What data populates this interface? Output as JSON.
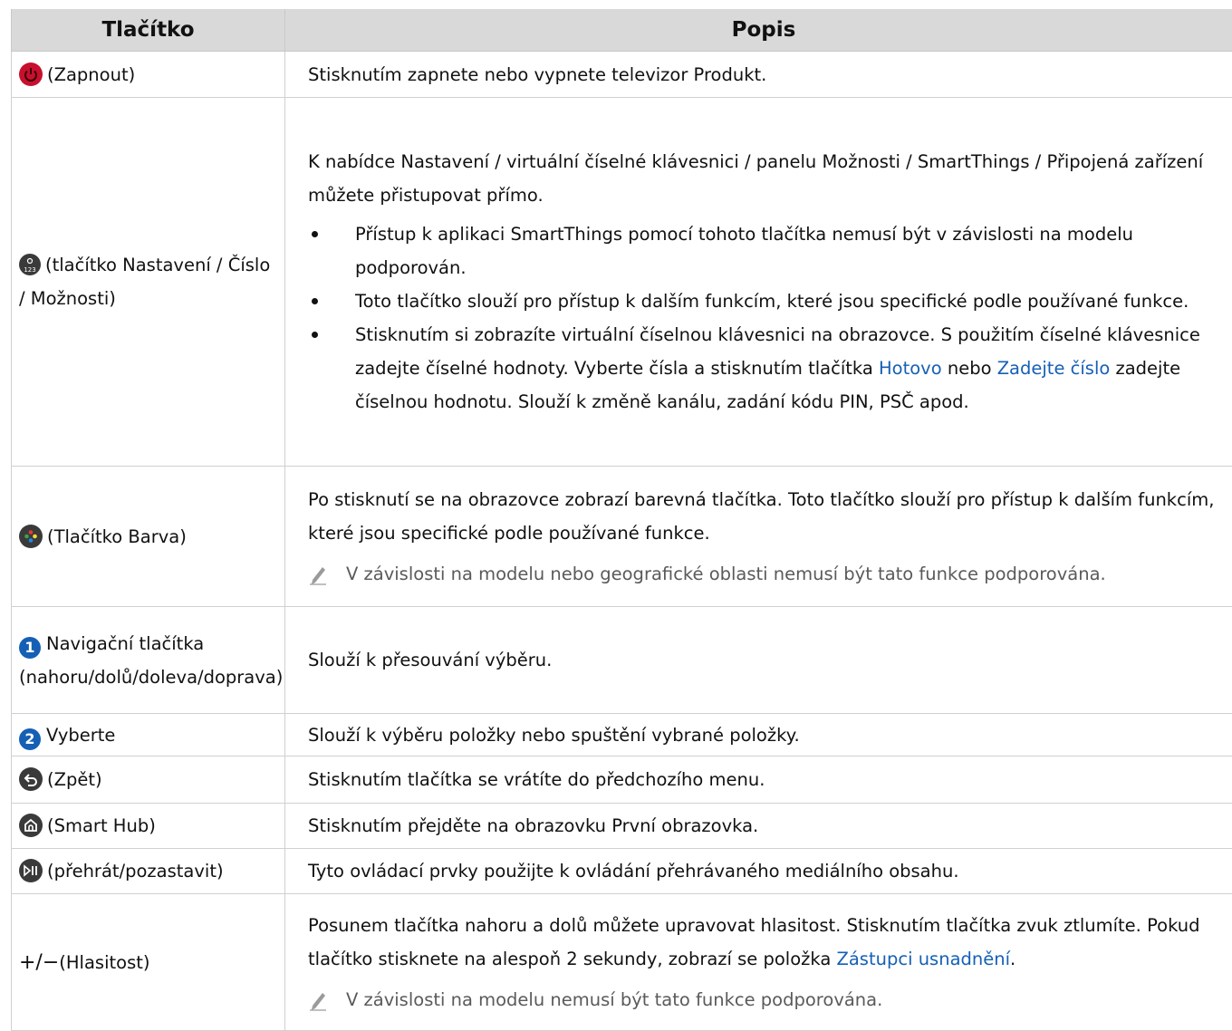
{
  "table": {
    "headers": {
      "button": "Tlačítko",
      "description": "Popis"
    },
    "rows": {
      "power": {
        "icon": "power-icon",
        "label": "(Zapnout)",
        "text": "Stisknutím zapnete nebo vypnete televizor Produkt."
      },
      "settings": {
        "icon": "settings-number-icon",
        "label": "(tlačítko Nastavení / Číslo / Možnosti)",
        "text": "K nabídce Nastavení / virtuální číselné klávesnici / panelu Možnosti / SmartThings / Připojená zařízení můžete přistupovat přímo.",
        "bullets": [
          "Přístup k aplikaci SmartThings pomocí tohoto tlačítka nemusí být v závislosti na modelu podporován.",
          "Toto tlačítko slouží pro přístup k dalším funkcím, které jsou specifické podle používané funkce."
        ],
        "bullet3_a": "Stisknutím si zobrazíte virtuální číselnou klávesnici na obrazovce. S použitím číselné klávesnice zadejte číselné hodnoty. Vyberte čísla a stisknutím tlačítka ",
        "bullet3_link1": "Hotovo",
        "bullet3_b": " nebo ",
        "bullet3_link2": "Zadejte číslo",
        "bullet3_c": " zadejte číselnou hodnotu. Slouží k změně kanálu, zadání kódu PIN, PSČ apod."
      },
      "color": {
        "icon": "color-button-icon",
        "label": "(Tlačítko Barva)",
        "text": "Po stisknutí se na obrazovce zobrazí barevná tlačítka. Toto tlačítko slouží pro přístup k dalším funkcím, které jsou specifické podle používané funkce.",
        "note": "V závislosti na modelu nebo geografické oblasti nemusí být tato funkce podporována."
      },
      "nav": {
        "number": "1",
        "label": "Navigační tlačítka (nahoru/dolů/doleva/doprava)",
        "text": "Slouží k přesouvání výběru."
      },
      "select": {
        "number": "2",
        "label": "Vyberte",
        "text": "Slouží k výběru položky nebo spuštění vybrané položky."
      },
      "back": {
        "icon": "back-icon",
        "label": "(Zpět)",
        "text": "Stisknutím tlačítka se vrátíte do předchozího menu."
      },
      "home": {
        "icon": "home-icon",
        "label": "(Smart Hub)",
        "text": "Stisknutím přejděte na obrazovku První obrazovka."
      },
      "play": {
        "icon": "play-pause-icon",
        "label": "(přehrát/pozastavit)",
        "text": "Tyto ovládací prvky použijte k ovládání přehrávaného mediálního obsahu."
      },
      "volume": {
        "symbol": "+/−",
        "label": "(Hlasitost)",
        "text_a": "Posunem tlačítka nahoru a dolů můžete upravovat hlasitost. Stisknutím tlačítka zvuk ztlumíte. Pokud tlačítko stisknete na alespoň 2 sekundy, zobrazí se položka ",
        "link": "Zástupci usnadnění",
        "text_b": ".",
        "note": "V závislosti na modelu nemusí být tato funkce podporována."
      }
    }
  },
  "colors": {
    "header_bg": "#d9d9d9",
    "link": "#1560b5",
    "power_red": "#c8102e",
    "icon_dark": "#3a3a3a"
  }
}
